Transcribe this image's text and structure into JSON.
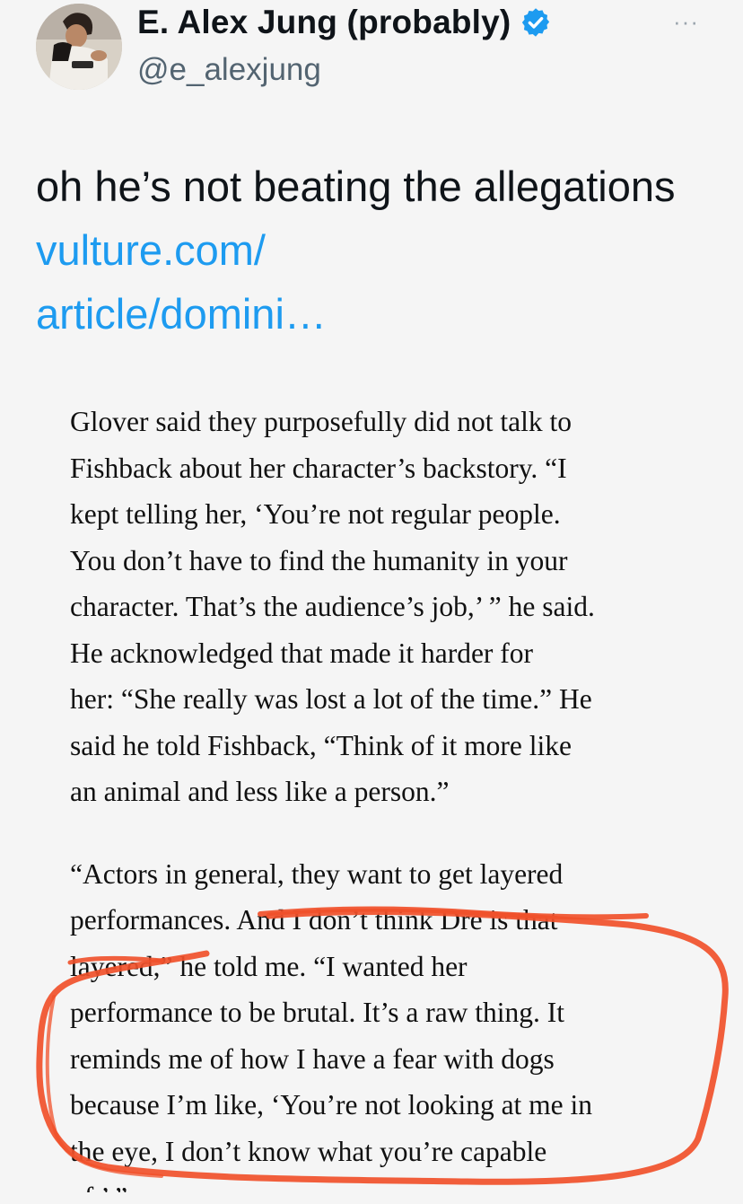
{
  "tweet": {
    "display_name": "E. Alex Jung (probably)",
    "handle": "@e_alexjung",
    "verified_icon": "verified-badge-icon",
    "more_icon": "more-icon",
    "more_glyph": "···",
    "text": "oh he’s not beating the allegations ",
    "link_text": "vulture.com/\narticle/domini…"
  },
  "screenshot_quote": {
    "paragraph_1": [
      "Glover said they purposefully did not talk to",
      "Fishback about her character’s backstory. “I",
      "kept telling her, ‘You’re not regular people.",
      "You don’t have to find the humanity in your",
      "character. That’s the audience’s job,’ ” he said.",
      "He acknowledged that made it harder for",
      "her: “She really was lost a lot of the time.” He",
      "said he told Fishback, “Think of it more like",
      "an animal and less like a person.”"
    ],
    "paragraph_2": [
      "“Actors in general, they want to get layered",
      "performances. And I don’t think Dre is that",
      "layered,” he told me. “I wanted her",
      "performance to be brutal. It’s a raw thing. It",
      "reminds me of how I have a fear with dogs",
      "because I’m like, ‘You’re not looking at me in",
      "the eye, I don’t know what you’re capable",
      "of.’ ”"
    ]
  },
  "colors": {
    "background": "#f5f5f5",
    "link": "#1d9bf0",
    "verified": "#1d9bf0",
    "annotation": "#f0502a"
  }
}
